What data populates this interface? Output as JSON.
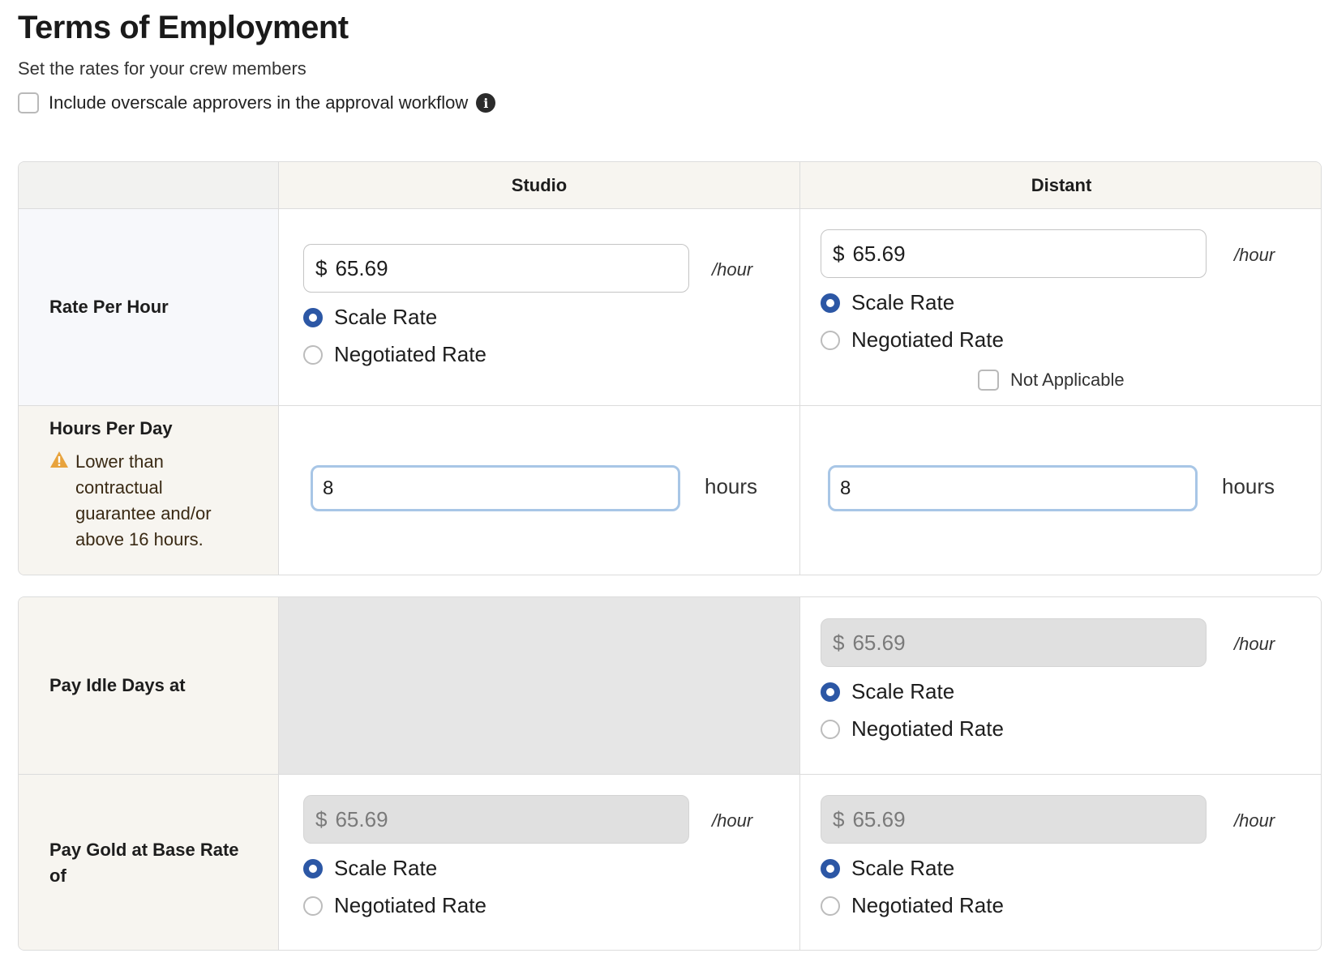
{
  "header": {
    "title": "Terms of Employment",
    "subtitle": "Set the rates for your crew members",
    "overscale_label": "Include overscale approvers in the approval workflow",
    "info_icon": "info-circle-icon"
  },
  "columns": {
    "studio": "Studio",
    "distant": "Distant"
  },
  "currency": "$",
  "units": {
    "per_hour": "/hour",
    "hours": "hours"
  },
  "radio_labels": {
    "scale": "Scale Rate",
    "negotiated": "Negotiated Rate"
  },
  "rows": {
    "rate_per_hour": {
      "label": "Rate Per Hour",
      "studio": {
        "value": "65.69",
        "selected": "scale"
      },
      "distant": {
        "value": "65.69",
        "selected": "scale",
        "not_applicable_label": "Not Applicable",
        "not_applicable_checked": false
      }
    },
    "hours_per_day": {
      "label": "Hours Per Day",
      "warning": "Lower than contractual guarantee and/or above 16 hours.",
      "studio": {
        "value": "8"
      },
      "distant": {
        "value": "8"
      }
    },
    "pay_idle_days": {
      "label": "Pay Idle Days at",
      "distant": {
        "value": "65.69",
        "selected": "scale"
      }
    },
    "pay_gold": {
      "label": "Pay Gold at Base Rate of",
      "studio": {
        "value": "65.69",
        "selected": "scale"
      },
      "distant": {
        "value": "65.69",
        "selected": "scale"
      }
    }
  },
  "colors": {
    "accent": "#2c57a5",
    "warning": "#e8a33d",
    "header_bg": "#f7f5f0",
    "focus_border": "#a8c6e6",
    "disabled_bg": "#e0e0e0"
  }
}
